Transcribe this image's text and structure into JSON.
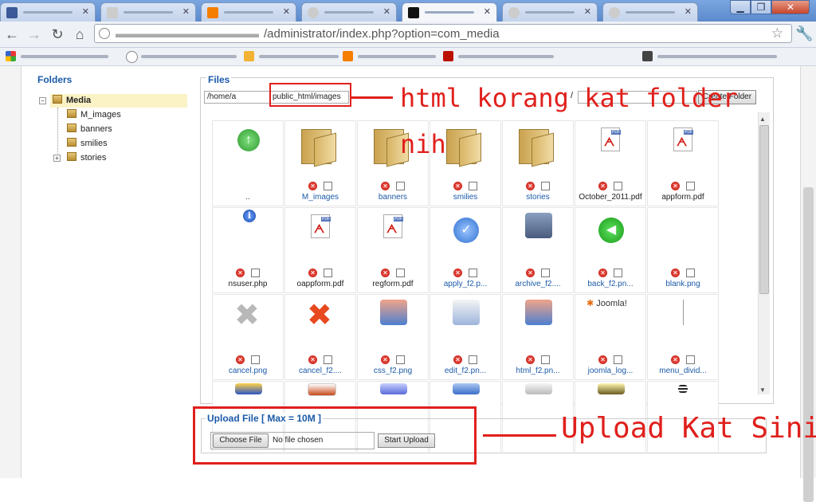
{
  "browser": {
    "address_path": "/administrator/index.php?option=com_media",
    "star_icon": "star-icon",
    "wrench_icon": "wrench-icon"
  },
  "sidebar": {
    "title": "Folders",
    "root": "Media",
    "folders": [
      "M_images",
      "banners",
      "smilies",
      "stories"
    ]
  },
  "files": {
    "title": "Files",
    "path_value": "/home/a",
    "folder_value": "public_html/images",
    "path_separator": "/",
    "create_folder_label": "Create Folder",
    "rows": [
      [
        {
          "label": "..",
          "icon": "up-arrow-icon",
          "link": false
        },
        {
          "label": "M_images",
          "icon": "folder-icon",
          "link": true
        },
        {
          "label": "banners",
          "icon": "folder-icon",
          "link": true
        },
        {
          "label": "smilies",
          "icon": "folder-icon",
          "link": true
        },
        {
          "label": "stories",
          "icon": "folder-icon",
          "link": true
        },
        {
          "label": "October_2011.pdf",
          "icon": "pdf-icon",
          "link": false
        },
        {
          "label": "appform.pdf",
          "icon": "pdf-icon",
          "link": false
        }
      ],
      [
        {
          "label": "nsuser.php",
          "icon": "info-icon",
          "link": false
        },
        {
          "label": "oappform.pdf",
          "icon": "pdf-icon",
          "link": false
        },
        {
          "label": "regform.pdf",
          "icon": "pdf-icon",
          "link": false
        },
        {
          "label": "apply_f2.p...",
          "icon": "apply-check-icon",
          "link": true
        },
        {
          "label": "archive_f2....",
          "icon": "archive-icon",
          "link": true
        },
        {
          "label": "back_f2.pn...",
          "icon": "back-arrow-icon",
          "link": true
        },
        {
          "label": "blank.png",
          "icon": "blank-icon",
          "link": true
        }
      ],
      [
        {
          "label": "cancel.png",
          "icon": "grey-x-icon",
          "link": true
        },
        {
          "label": "cancel_f2....",
          "icon": "red-x-icon",
          "link": true
        },
        {
          "label": "css_f2.png",
          "icon": "css-icon",
          "link": true
        },
        {
          "label": "edit_f2.pn...",
          "icon": "edit-icon",
          "link": true
        },
        {
          "label": "html_f2.pn...",
          "icon": "html-icon",
          "link": true
        },
        {
          "label": "joomla_log...",
          "icon": "joomla-logo-icon",
          "link": true
        },
        {
          "label": "menu_divid...",
          "icon": "menu-divider-icon",
          "link": true
        }
      ]
    ],
    "joomla_logo_text": "Joomla!"
  },
  "upload": {
    "legend": "Upload File [ Max = 10M ]",
    "choose_label": "Choose File",
    "file_status": "No file chosen",
    "start_label": "Start Upload"
  },
  "annotations": {
    "folder_note_line1": "html korang kat folder",
    "folder_note_line2": "nih",
    "upload_note": "Upload Kat Sini",
    "color": "#e0201c"
  }
}
